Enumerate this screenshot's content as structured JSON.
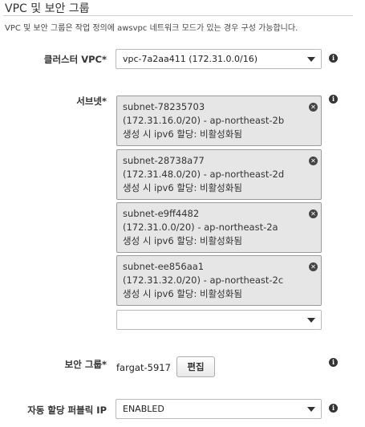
{
  "section": {
    "title": "VPC 및 보안 그룹",
    "description": "VPC 및 보안 그룹은 작업 정의에 awsvpc 네트워크 모드가 있는 경우 구성 가능합니다."
  },
  "cluster_vpc": {
    "label": "클러스터 VPC*",
    "value": "vpc-7a2aa411 (172.31.0.0/16)"
  },
  "subnets": {
    "label": "서브넷*",
    "items": [
      {
        "id": "subnet-78235703",
        "detail": "(172.31.16.0/20) - ap-northeast-2b",
        "ipv6": "생성 시 ipv6 할당: 비활성화됨"
      },
      {
        "id": "subnet-28738a77",
        "detail": "(172.31.48.0/20) - ap-northeast-2d",
        "ipv6": "생성 시 ipv6 할당: 비활성화됨"
      },
      {
        "id": "subnet-e9ff4482",
        "detail": "(172.31.0.0/20) - ap-northeast-2a",
        "ipv6": "생성 시 ipv6 할당: 비활성화됨"
      },
      {
        "id": "subnet-ee856aa1",
        "detail": "(172.31.32.0/20) - ap-northeast-2c",
        "ipv6": "생성 시 ipv6 할당: 비활성화됨"
      }
    ],
    "add_select_value": ""
  },
  "security_group": {
    "label": "보안 그룹*",
    "value": "fargat-5917",
    "edit_label": "편집"
  },
  "public_ip": {
    "label": "자동 할당 퍼블릭 IP",
    "value": "ENABLED"
  },
  "icons": {
    "info": "i",
    "remove": "✕"
  }
}
